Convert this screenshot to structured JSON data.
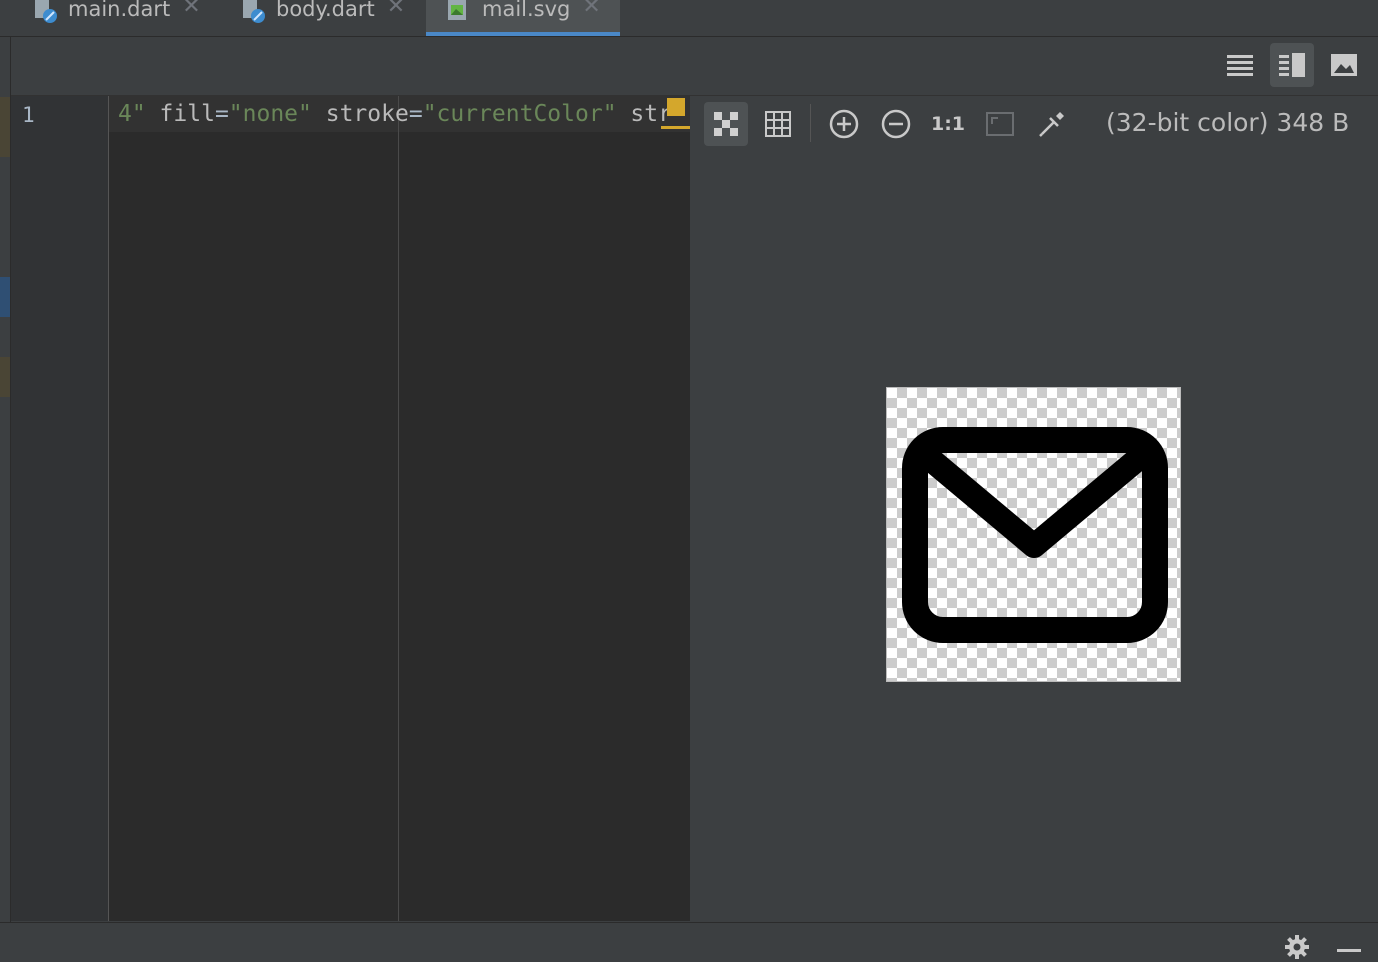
{
  "tabs": [
    {
      "label": "main.dart",
      "icon": "dart-file-icon",
      "active": false
    },
    {
      "label": "body.dart",
      "icon": "dart-file-icon",
      "active": false
    },
    {
      "label": "mail.svg",
      "icon": "image-file-icon",
      "active": true
    }
  ],
  "tab_close_glyph": "✕",
  "view_modes": [
    "editor-only",
    "editor-and-preview",
    "preview-only"
  ],
  "selected_view_mode": "editor-and-preview",
  "editor": {
    "line_number": "1",
    "code_tokens": [
      {
        "text": "4\" ",
        "kind": "string"
      },
      {
        "text": "fill",
        "kind": "attr"
      },
      {
        "text": "=",
        "kind": "plain"
      },
      {
        "text": "\"none\" ",
        "kind": "string"
      },
      {
        "text": "stroke",
        "kind": "attr"
      },
      {
        "text": "=",
        "kind": "plain"
      },
      {
        "text": "\"currentColor\" ",
        "kind": "string"
      },
      {
        "text": "str",
        "kind": "attr"
      }
    ]
  },
  "preview_toolbar": {
    "actual_size_label": "1:1",
    "image_info": "(32-bit color) 348 B"
  },
  "colors": {
    "accent": "#4a88c7",
    "string": "#6a8759",
    "warning": "#d4a72c",
    "background": "#3c3f41",
    "editor_bg": "#2b2b2b"
  }
}
